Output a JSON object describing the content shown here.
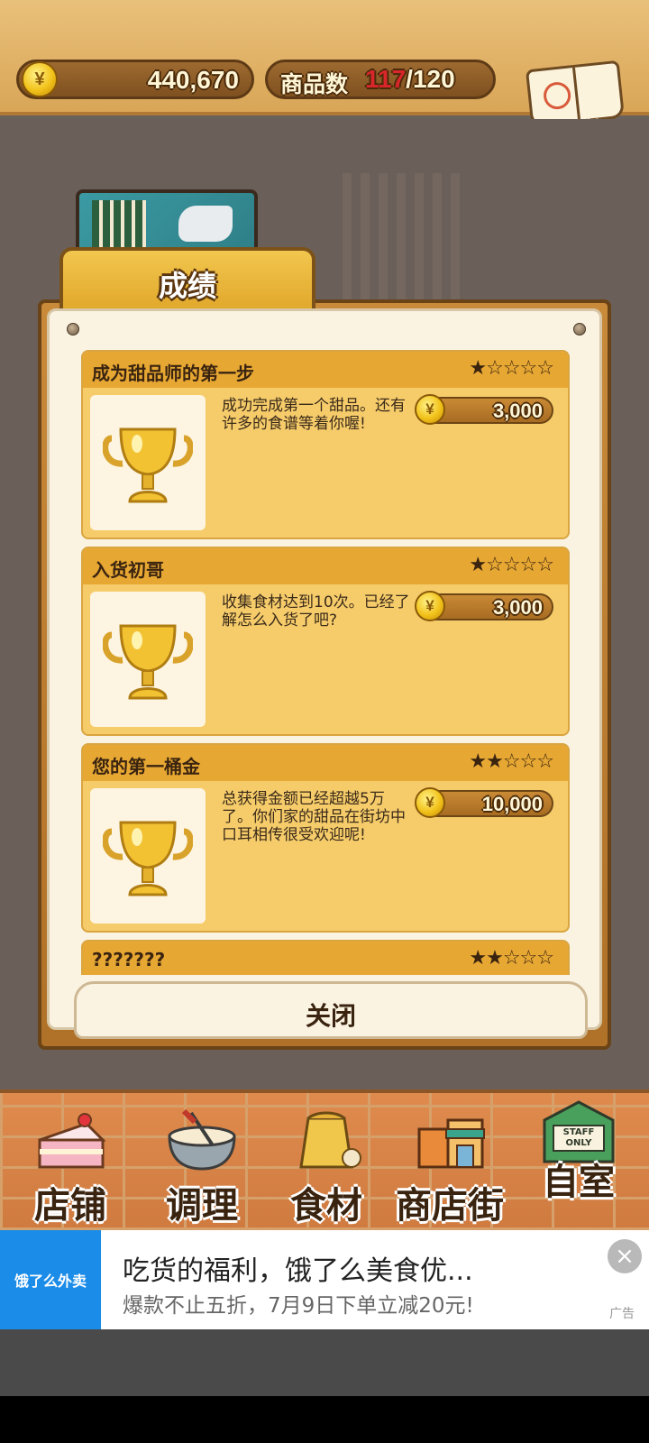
{
  "topbar": {
    "money": "440,670",
    "coin_symbol": "¥",
    "goods_label": "商品数",
    "goods_current": "117",
    "goods_separator": "/",
    "goods_max": "120",
    "recipe_label": "食谱"
  },
  "panel": {
    "tab_title": "成绩",
    "close_label": "关闭",
    "achievements": [
      {
        "title": "成为甜品师的第一步",
        "stars": "★☆☆☆☆",
        "description": "成功完成第一个甜品。还有许多的食谱等着你喔!",
        "reward": "3,000"
      },
      {
        "title": "入货初哥",
        "stars": "★☆☆☆☆",
        "description": "收集食材达到10次。已经了解怎么入货了吧?",
        "reward": "3,000"
      },
      {
        "title": "您的第一桶金",
        "stars": "★★☆☆☆",
        "description": "总获得金额已经超越5万了。你们家的甜品在街坊中口耳相传很受欢迎呢!",
        "reward": "10,000"
      },
      {
        "title": "???????",
        "stars": "★★☆☆☆",
        "description": "",
        "reward": ""
      }
    ]
  },
  "nav": {
    "items": [
      {
        "label": "店铺",
        "icon": "cake-icon"
      },
      {
        "label": "调理",
        "icon": "mixing-bowl-icon"
      },
      {
        "label": "食材",
        "icon": "flour-sack-icon"
      },
      {
        "label": "商店街",
        "icon": "shop-street-icon"
      },
      {
        "label": "自室",
        "icon": "staff-only-door-icon"
      }
    ],
    "staff_sign": "STAFF ONLY"
  },
  "ad": {
    "logo_text": "饿了么外卖",
    "title": "吃货的福利，饿了么美食优...",
    "subtitle": "爆款不止五折，7月9日下单立减20元!",
    "tag": "广告",
    "close_symbol": "×"
  },
  "colors": {
    "accent_red": "#d8262a",
    "card_bg": "#f6cc6a",
    "card_header": "#e7a733",
    "ad_blue": "#1b8ce8"
  }
}
